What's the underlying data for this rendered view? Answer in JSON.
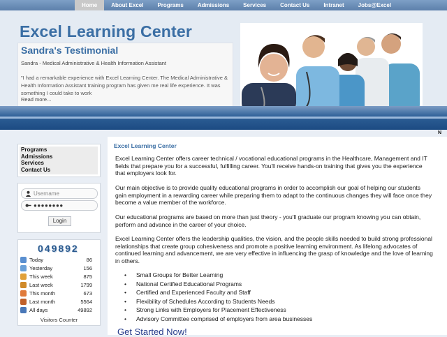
{
  "nav": {
    "items": [
      "Home",
      "About Excel",
      "Programs",
      "Admissions",
      "Services",
      "Contact Us",
      "Intranet",
      "Jobs@Excel"
    ]
  },
  "header": {
    "site_title": "Excel Learning Center"
  },
  "testimonial": {
    "title": "Sandra's Testimonial",
    "subtitle": "Sandra - Medical Administrative & Health Information Assistant",
    "quote": "\"I had a remarkable experience with Excel Learning Center. The Medical Administrative & Health Information Assistant training program has given me real life experience. It was something I could take to work",
    "more": "Read more..."
  },
  "banner": {
    "corner_text": "N"
  },
  "sidebar": {
    "links": [
      "Programs",
      "Admissions",
      "Services",
      "Contact Us"
    ]
  },
  "login": {
    "username_placeholder": "Username",
    "password_value": "●●●●●●●●",
    "button": "Login"
  },
  "counter": {
    "digits": "049892",
    "rows": [
      {
        "label": "Today",
        "value": "86"
      },
      {
        "label": "Yesterday",
        "value": "156"
      },
      {
        "label": "This week",
        "value": "875"
      },
      {
        "label": "Last week",
        "value": "1799"
      },
      {
        "label": "This month",
        "value": "673"
      },
      {
        "label": "Last month",
        "value": "5564"
      },
      {
        "label": "All days",
        "value": "49892"
      }
    ],
    "caption": "Visitors Counter"
  },
  "content": {
    "title": "Excel Learning Center",
    "paragraphs": [
      "Excel Learning Center offers career technical / vocational educational programs in the Healthcare, Management and IT fields that prepare you for a successful, fulfilling career. You'll receive hands-on training that gives you the experience that employers look for.",
      "Our main objective is to provide quality educational programs in order to accomplish our goal of helping our students gain employment in a rewarding career while preparing them to adapt to the continuous changes they will face once they become a value member of the workforce.",
      "Our educational programs are based on more than just theory - you'll graduate our program knowing you can obtain, perform and advance in the career of your choice.",
      "Excel Learning Center offers the leadership qualities, the vision, and the people skills needed to build strong professional relationships that create group cohesiveness and promote a positive learning environment. As lifelong advocates of continued learning and advancement, we are very effective in influencing the grasp of knowledge and the love of learning in others."
    ],
    "bullets": [
      "Small Groups for Better Learning",
      "National Certified Educational Programs",
      "Certified and Experienced Faculty and Staff",
      "Flexibility of Schedules According to Students Needs",
      "Strong Links with Employers for Placement Effectiveness",
      "Advisory Committee comprised of employers from area businesses"
    ],
    "cta": "Get Started Now!"
  },
  "colors": {
    "accent": "#3a6ea4",
    "nav_bar": "#6a8db8",
    "band": "#2d5e96"
  },
  "icons": {
    "username": "user-icon",
    "password": "key-icon"
  }
}
